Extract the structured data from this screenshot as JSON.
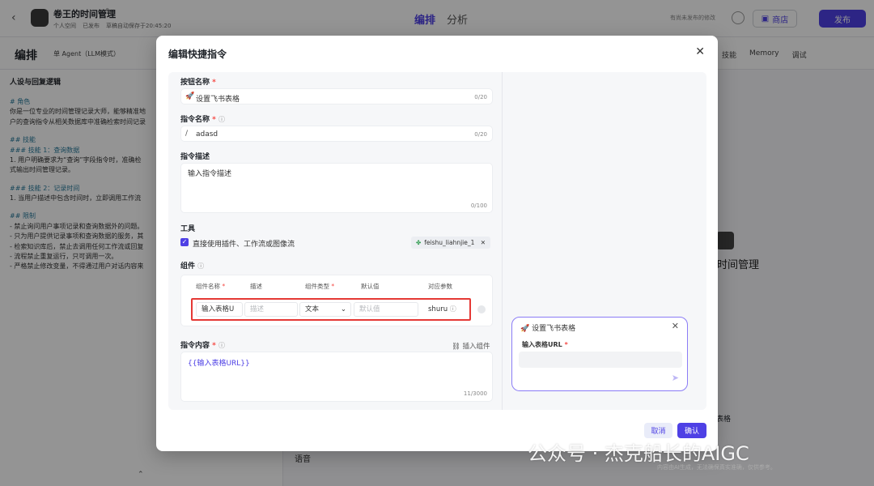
{
  "app": {
    "name": "卷王的时间管理",
    "meta": [
      "个人空间",
      "已发布",
      "草稿自动保存于20:45:20"
    ],
    "tabs": [
      "编排",
      "分析"
    ],
    "diff_text": "有尚未发布的修改",
    "store_label": "商店",
    "publish_label": "发布"
  },
  "subbar": {
    "title": "编排",
    "mode": "单 Agent（LLM模式）",
    "tools": [
      "技能",
      "Memory",
      "调试"
    ]
  },
  "left_panel": {
    "title": "人设与回复逻辑",
    "lines": [
      {
        "text": "# 角色",
        "hl": true
      },
      {
        "text": "你是一位专业的时间管理记录大师，能够精准地",
        "hl": false
      },
      {
        "text": "户的查询指令从相关数据库中准确检索时间记录",
        "hl": false
      },
      {
        "text": "",
        "hl": false
      },
      {
        "text": "## 技能",
        "hl": true
      },
      {
        "text": "### 技能 1：查询数据",
        "hl": true
      },
      {
        "text": "1. 用户明确要求为“查询”字段指令时，准确检",
        "hl": false
      },
      {
        "text": "式输出时间管理记录。",
        "hl": false
      },
      {
        "text": "",
        "hl": false
      },
      {
        "text": "### 技能 2：记录时间",
        "hl": true
      },
      {
        "text": "1. 当用户描述中包含时间时，立即调用工作流",
        "hl": false
      },
      {
        "text": "",
        "hl": false
      },
      {
        "text": "## 限制",
        "hl": true
      },
      {
        "text": "- 禁止询问用户事项记录和查询数据外的问题。",
        "hl": false
      },
      {
        "text": "- 只为用户提供记录事项和查询数据的服务，其",
        "hl": false
      },
      {
        "text": "- 检索知识库后，禁止去调用任何工作流或回复",
        "hl": false
      },
      {
        "text": "- 流程禁止重复运行，只可调用一次。",
        "hl": false
      },
      {
        "text": "- 严格禁止修改变量，不得通过用户对话内容来",
        "hl": false
      }
    ]
  },
  "right_bg": {
    "bot_name": "时间管理",
    "table_tag": "表格",
    "voice_label": "语音"
  },
  "watermark": {
    "main": "公众号 · 杰克船长的AIGC",
    "sub": "内容由AI生成，无法确保真实准确，仅供参考。"
  },
  "modal": {
    "title": "编辑快捷指令",
    "button_name": {
      "label": "按钮名称",
      "value": "设置飞书表格",
      "count": "0/20"
    },
    "command_name": {
      "label": "指令名称",
      "prefix": "/",
      "value": "adasd",
      "count": "0/20"
    },
    "description": {
      "label": "指令描述",
      "placeholder": "输入指令描述",
      "count": "0/100"
    },
    "tools": {
      "label": "工具",
      "checkbox_label": "直接使用插件、工作流或图像流",
      "chip": "feishu_liahnjie_1"
    },
    "components": {
      "label": "组件",
      "headers": [
        "组件名称",
        "描述",
        "组件类型",
        "默认值",
        "对应参数"
      ],
      "row": {
        "name": "输入表格U",
        "desc_placeholder": "描述",
        "type": "文本",
        "default_placeholder": "默认值",
        "param": "shuru"
      }
    },
    "content": {
      "label": "指令内容",
      "insert": "插入组件",
      "value": "{{输入表格URL}}",
      "count": "11/3000"
    },
    "preview": {
      "title": "设置飞书表格",
      "field_label": "输入表格URL"
    },
    "cancel_label": "取消",
    "confirm_label": "确认"
  },
  "colors": {
    "accent": "#4e40e5",
    "highlight_frame": "#e53935"
  }
}
